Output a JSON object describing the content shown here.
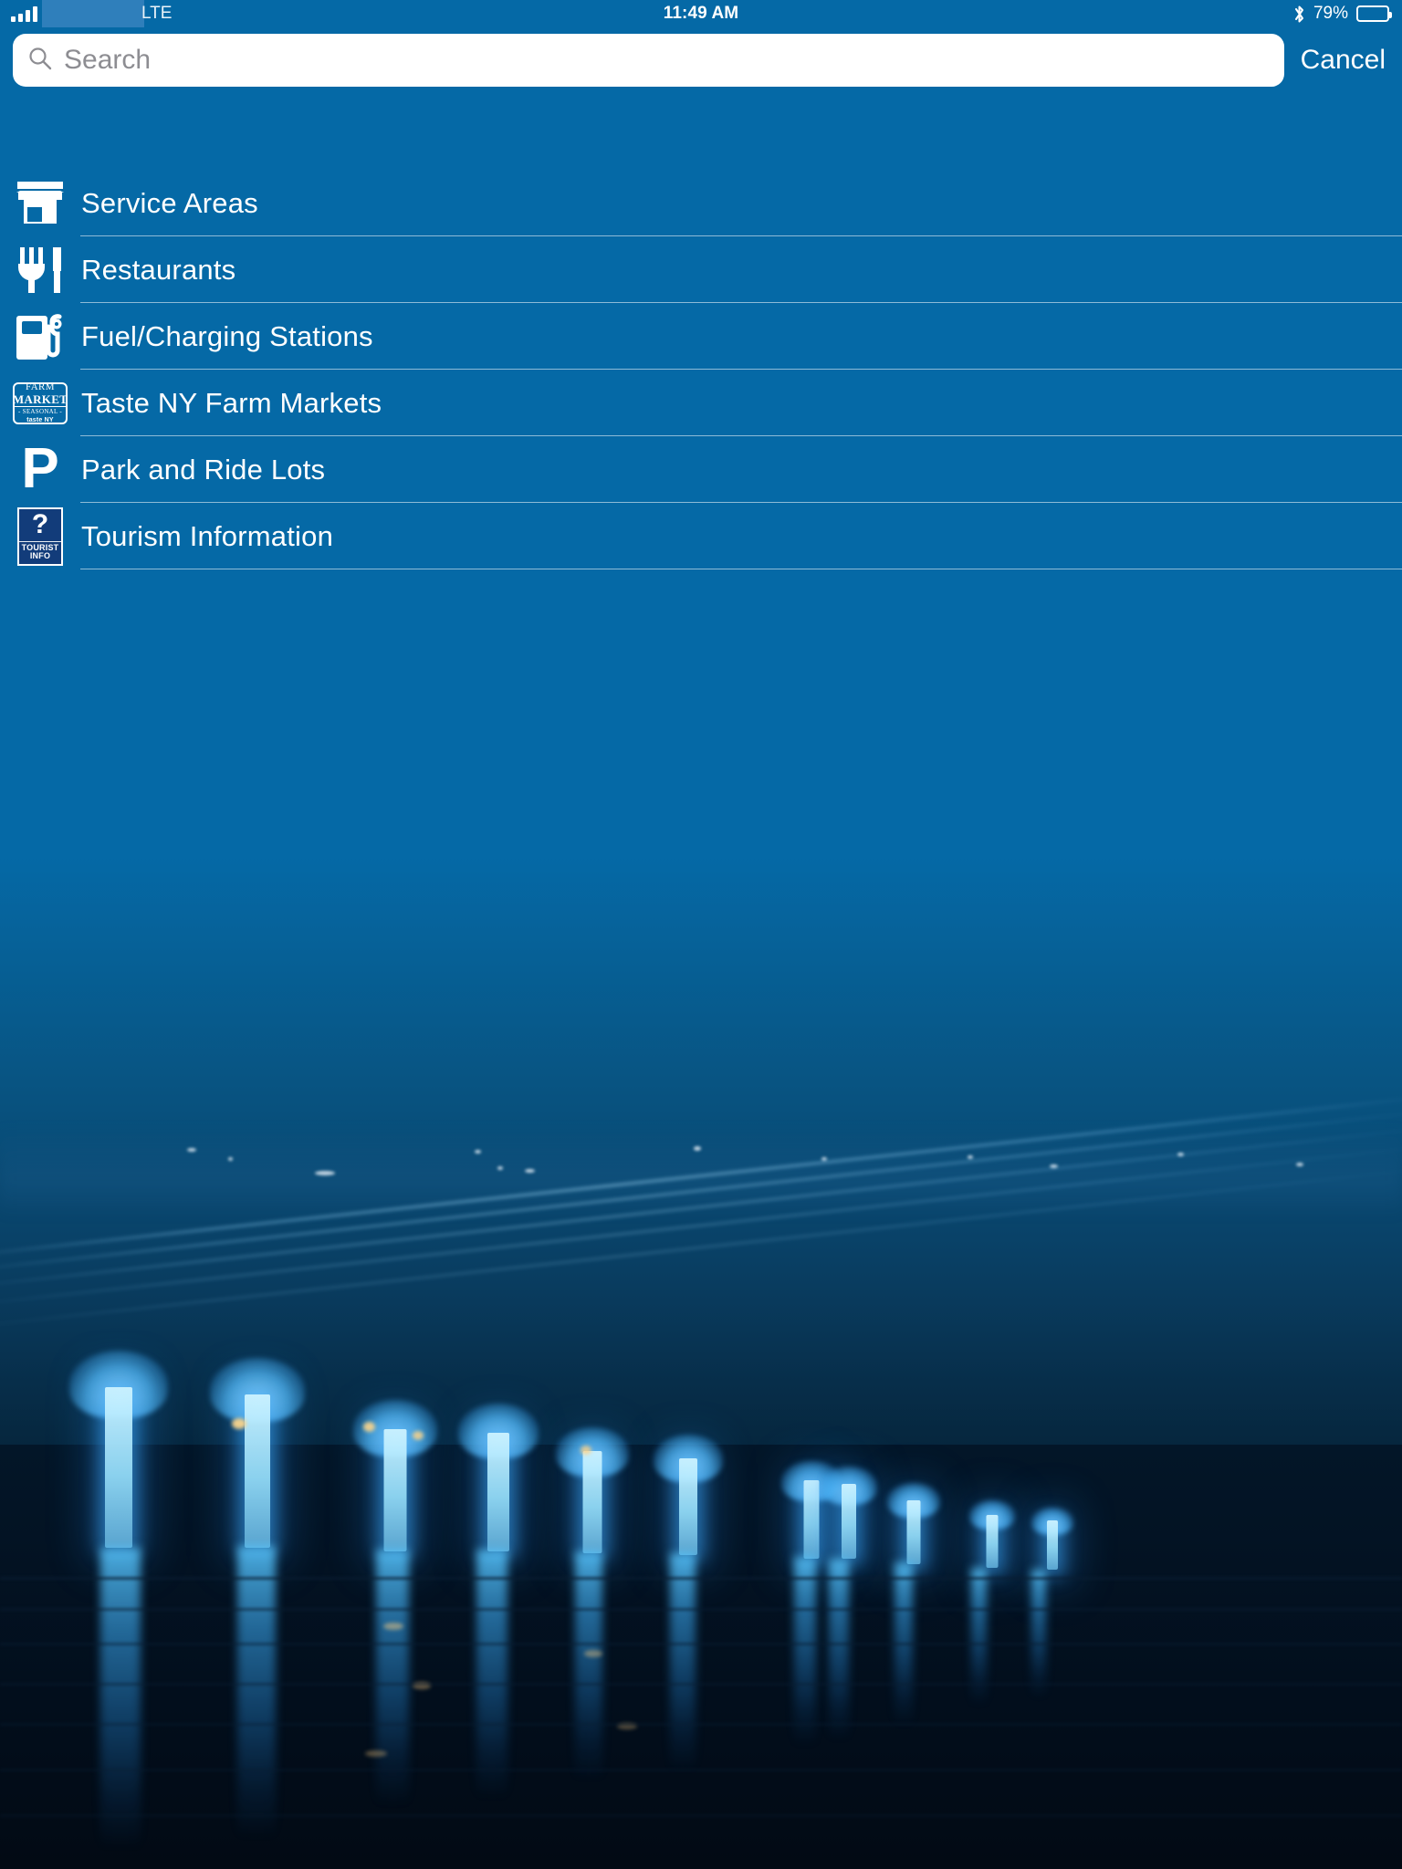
{
  "status_bar": {
    "signal_icon": "signal-bars-icon",
    "carrier_redacted": "",
    "network": "LTE",
    "time": "11:49 AM",
    "bluetooth_icon": "bluetooth-icon",
    "battery_percent": "79%",
    "battery_icon": "battery-icon"
  },
  "search": {
    "icon": "search-icon",
    "placeholder": "Search",
    "value": "",
    "cancel_label": "Cancel"
  },
  "menu": {
    "items": [
      {
        "label": "Service Areas",
        "icon": "storefront-icon"
      },
      {
        "label": "Restaurants",
        "icon": "fork-knife-icon"
      },
      {
        "label": "Fuel/Charging Stations",
        "icon": "fuel-pump-icon"
      },
      {
        "label": "Taste NY Farm Markets",
        "icon": "farm-market-badge-icon"
      },
      {
        "label": "Park and Ride Lots",
        "icon": "parking-p-icon"
      },
      {
        "label": "Tourism Information",
        "icon": "tourist-info-sign-icon"
      }
    ]
  },
  "farm_badge": {
    "line1": "FARM",
    "line2": "MARKET",
    "line3": "- SEASONAL -",
    "line4": "taste NY"
  },
  "tourist_badge": {
    "question_mark": "?",
    "line1": "TOURIST",
    "line2": "INFO"
  },
  "parking_badge": {
    "letter": "P"
  },
  "background": {
    "description": "Blurred night photograph of an illuminated suspension bridge over water with glowing blue piers and reflections",
    "accent_blue": "#0569a6",
    "pier_glow": "#5ac8ff"
  }
}
